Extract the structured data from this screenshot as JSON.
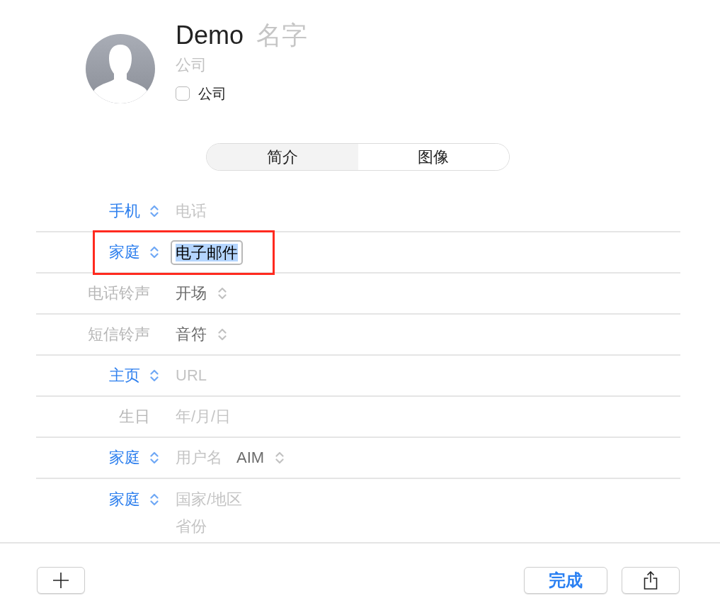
{
  "header": {
    "name_fields": [
      {
        "value": "Demo"
      },
      {
        "placeholder": "名字"
      }
    ],
    "company_field": {
      "placeholder": "公司"
    },
    "company_checkbox": {
      "label": "公司",
      "checked": false
    }
  },
  "tabs": [
    {
      "label": "简介",
      "selected": true
    },
    {
      "label": "图像",
      "selected": false
    }
  ],
  "fields": [
    {
      "label": "手机",
      "label_picker": true,
      "kind": "text",
      "placeholder": "电话",
      "editing": false,
      "highlighted": false
    },
    {
      "label": "家庭",
      "label_picker": true,
      "kind": "text",
      "value": "电子邮件",
      "editing": true,
      "highlighted": true
    },
    {
      "label": "电话铃声",
      "label_picker": false,
      "kind": "popup",
      "value": "开场",
      "highlighted": false
    },
    {
      "label": "短信铃声",
      "label_picker": false,
      "kind": "popup",
      "value": "音符",
      "highlighted": false
    },
    {
      "label": "主页",
      "label_picker": true,
      "kind": "text",
      "placeholder": "URL",
      "editing": false,
      "highlighted": false
    },
    {
      "label": "生日",
      "label_picker": false,
      "kind": "text",
      "placeholder": "年/月/日",
      "editing": false,
      "highlighted": false
    },
    {
      "label": "家庭",
      "label_picker": true,
      "kind": "im",
      "placeholder": "用户名",
      "service": "AIM",
      "highlighted": false
    },
    {
      "label": "家庭",
      "label_picker": true,
      "kind": "address",
      "lines": [
        {
          "placeholder": "国家/地区"
        },
        {
          "placeholder": "省份"
        }
      ],
      "highlighted": false
    }
  ],
  "footer": {
    "done_button": "完成"
  }
}
